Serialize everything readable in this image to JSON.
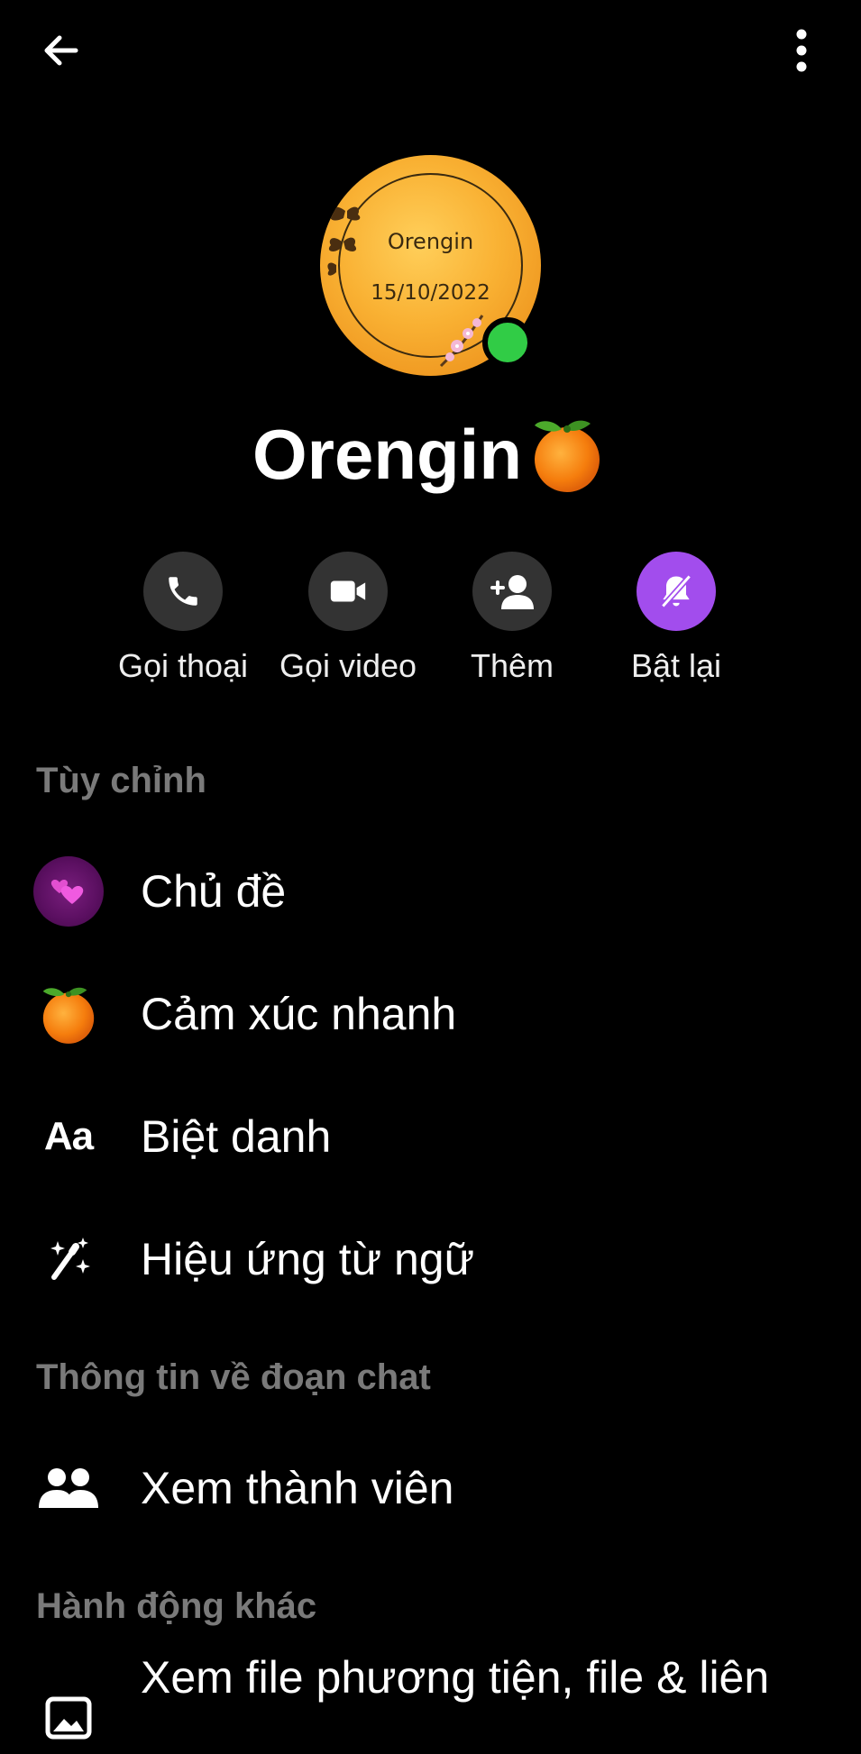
{
  "header": {
    "back_icon": "back-arrow-icon",
    "more_icon": "more-vertical-icon"
  },
  "profile": {
    "avatar_text_name": "Orengin",
    "avatar_text_date": "15/10/2022",
    "name": "Orengin",
    "name_emoji": "tangerine-emoji",
    "online": true,
    "colors": {
      "online": "#31cc46",
      "avatar": "#f9b133"
    }
  },
  "actions": [
    {
      "label": "Gọi thoại",
      "icon": "phone-icon"
    },
    {
      "label": "Gọi video",
      "icon": "video-camera-icon"
    },
    {
      "label": "Thêm",
      "icon": "add-person-icon"
    },
    {
      "label": "Bật lại",
      "icon": "bell-muted-icon",
      "accent": "#a24ded"
    }
  ],
  "sections": {
    "customize": {
      "title": "Tùy chỉnh",
      "items": [
        {
          "label": "Chủ đề",
          "icon": "theme-hearts-icon"
        },
        {
          "label": "Cảm xúc nhanh",
          "icon": "tangerine-emoji"
        },
        {
          "label": "Biệt danh",
          "icon": "aa-text-icon",
          "icon_text": "Aa"
        },
        {
          "label": "Hiệu ứng từ ngữ",
          "icon": "magic-wand-icon"
        }
      ]
    },
    "chat_info": {
      "title": "Thông tin về đoạn chat",
      "items": [
        {
          "label": "Xem thành viên",
          "icon": "people-icon"
        }
      ]
    },
    "other_actions": {
      "title": "Hành động khác",
      "items": [
        {
          "label": "Xem file phương tiện, file & liên",
          "icon": "image-icon"
        }
      ]
    }
  }
}
